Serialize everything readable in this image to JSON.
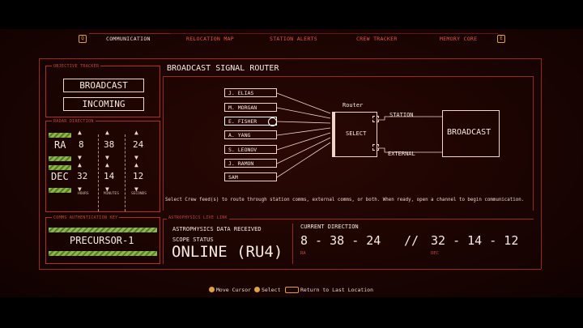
{
  "nav": {
    "left_key": "Q",
    "right_key": "E",
    "tabs": [
      "COMMUNICATION",
      "RELOCATION MAP",
      "STATION ALERTS",
      "CREW TRACKER",
      "MEMORY CORE"
    ]
  },
  "objective": {
    "label": "OBJECTIVE TRACKER",
    "line1": "BROADCAST",
    "line2": "INCOMING"
  },
  "radar": {
    "label": "RADAR DIRECTION",
    "ra_label": "RA",
    "dec_label": "DEC",
    "ra_values": [
      "8",
      "38",
      "24"
    ],
    "dec_values": [
      "32",
      "14",
      "12"
    ],
    "units": [
      "HOURS",
      "MINUTES",
      "SECONDS"
    ]
  },
  "comms_key": {
    "label": "COMMS AUTHENTICATION KEY",
    "value": "PRECURSOR-1"
  },
  "router": {
    "title": "BROADCAST SIGNAL ROUTER",
    "crew": [
      "J. ELIAS",
      "M. MORGAN",
      "E. FISHER",
      "A. YANG",
      "S. LEONOV",
      "J. RAMON",
      "SAM"
    ],
    "router_label": "Router",
    "select_label": "SELECT",
    "station_label": "STATION",
    "external_label": "EXTERNAL",
    "broadcast_label": "BROADCAST",
    "instructions": "Select Crew feed(s) to route through station comms, external comms, or both. When ready, open a channel to begin communication."
  },
  "astro": {
    "label": "ASTROPHYSICS LIVE LINK",
    "data_received": "ASTROPHYSICS DATA RECEIVED",
    "scope_status_label": "SCOPE STATUS",
    "scope_status": "ONLINE (RU4)",
    "current_direction_label": "CURRENT DIRECTION",
    "ra_reading": "8 - 38 - 24",
    "separator": "//",
    "dec_reading": "32 - 14 - 12",
    "ra_sub": "RA",
    "dec_sub": "DEC"
  },
  "footer": {
    "move": "Move Cursor",
    "select": "Select",
    "return": "Return to Last Location"
  }
}
